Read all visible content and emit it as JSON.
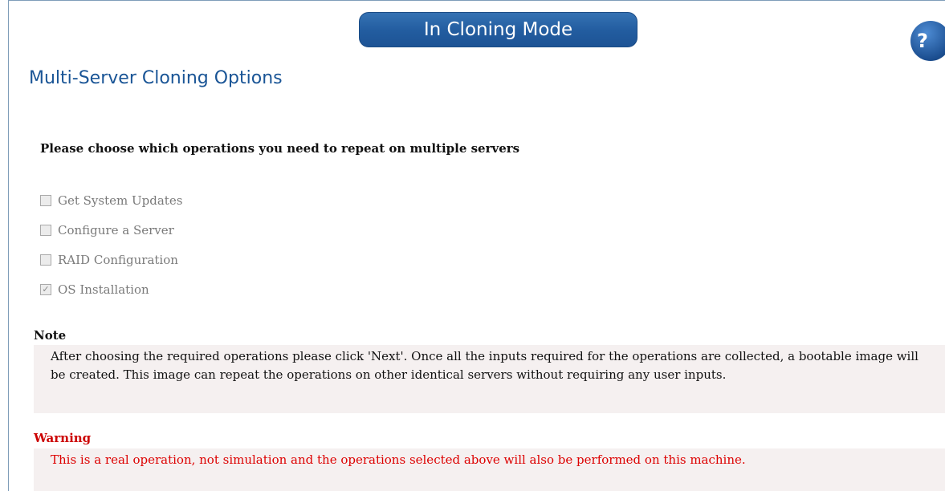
{
  "banner": {
    "label": "In Cloning Mode"
  },
  "help": {
    "icon": "question-mark-icon",
    "glyph": "?"
  },
  "page_title": "Multi-Server Cloning Options",
  "instruction": "Please choose which operations you need to repeat on multiple servers",
  "options": [
    {
      "label": "Get System Updates",
      "checked": false,
      "disabled": true
    },
    {
      "label": "Configure a Server",
      "checked": false,
      "disabled": true
    },
    {
      "label": "RAID Configuration",
      "checked": false,
      "disabled": true
    },
    {
      "label": "OS Installation",
      "checked": true,
      "disabled": true
    }
  ],
  "note": {
    "heading": "Note",
    "text": "After choosing the required operations please click 'Next'. Once all the inputs required for the operations are collected, a bootable image will be created. This image can repeat the operations on other identical servers without requiring any user inputs."
  },
  "warning": {
    "heading": "Warning",
    "text": "This is a real operation, not simulation and the operations selected above will also be performed on this machine."
  },
  "colors": {
    "banner_bg": "#225c9f",
    "title": "#1a5596",
    "warning_text": "#dd0000",
    "note_bg": "#f5f0f0"
  }
}
